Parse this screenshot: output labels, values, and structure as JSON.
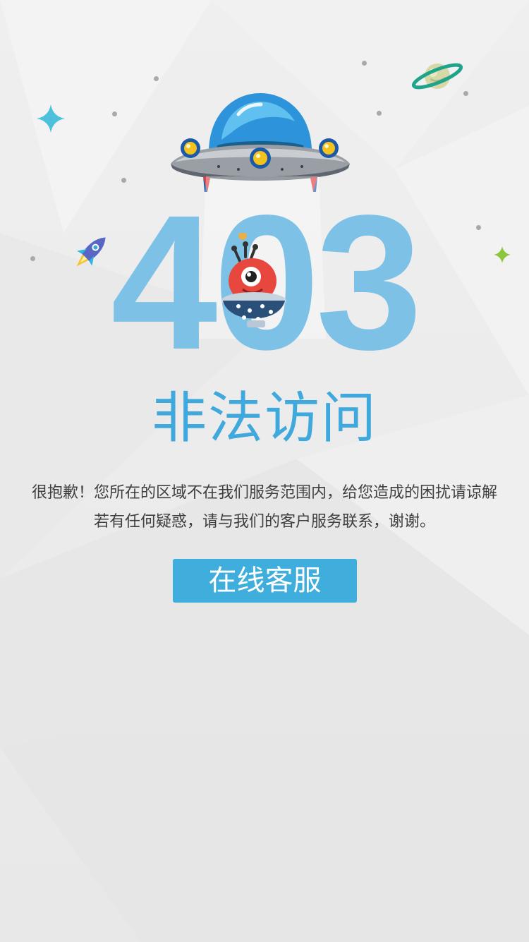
{
  "error": {
    "code": "403",
    "title": "非法访问",
    "message_line1": "很抱歉！您所在的区域不在我们服务范围内，给您造成的困扰请谅解",
    "message_line2": "若有任何疑惑，请与我们的客户服务联系，谢谢。"
  },
  "actions": {
    "service_button_label": "在线客服"
  },
  "colors": {
    "accent": "#40aedd",
    "code": "#7dc2e6",
    "title": "#3fa8dc",
    "text": "#3f3f3f",
    "background": "#ececec"
  },
  "icons": [
    "ufo-illustration",
    "alien-monster-illustration",
    "rocket-icon",
    "planet-icon",
    "sparkle-star-icon",
    "green-star-icon"
  ]
}
